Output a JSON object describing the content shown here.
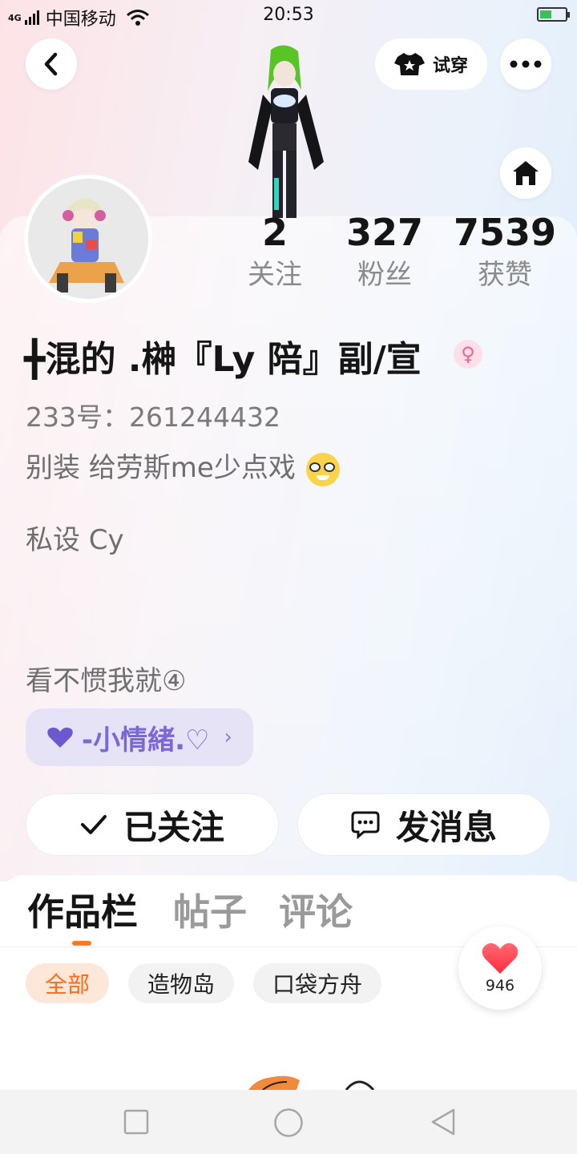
{
  "status_bar": {
    "network": "4G",
    "carrier": "中国移动",
    "time": "20:53",
    "battery_level": 0.45
  },
  "header": {
    "back_icon": "chevron-left-icon",
    "try_on_label": "试穿",
    "more_icon": "more-dots-icon",
    "home_icon": "home-icon"
  },
  "stats": [
    {
      "value": "2",
      "label": "关注"
    },
    {
      "value": "327",
      "label": "粉丝"
    },
    {
      "value": "7539",
      "label": "获赞"
    }
  ],
  "profile": {
    "username": "╋混的 .榊『Ly 陪』副/宣",
    "gender_icon": "female-icon",
    "uid": "233号：261244432",
    "bio_line1": "别装 给劳斯me少点戏",
    "bio_line2": "私设 Cy",
    "bio_line3": "看不惯我就④",
    "mood_label": "-小情緒.♡"
  },
  "actions": {
    "followed_label": "已关注",
    "message_label": "发消息"
  },
  "tabs": [
    {
      "label": "作品栏",
      "active": true
    },
    {
      "label": "帖子",
      "active": false
    },
    {
      "label": "评论",
      "active": false
    }
  ],
  "filters": [
    {
      "label": "全部",
      "active": true
    },
    {
      "label": "造物岛",
      "active": false
    },
    {
      "label": "口袋方舟",
      "active": false
    }
  ],
  "like_badge": {
    "count": "946"
  },
  "colors": {
    "accent_orange": "#ff6a1a",
    "mood_purple": "#7b67d6",
    "heart_red": "#ff3b4e",
    "female_pink": "#f0609a"
  }
}
